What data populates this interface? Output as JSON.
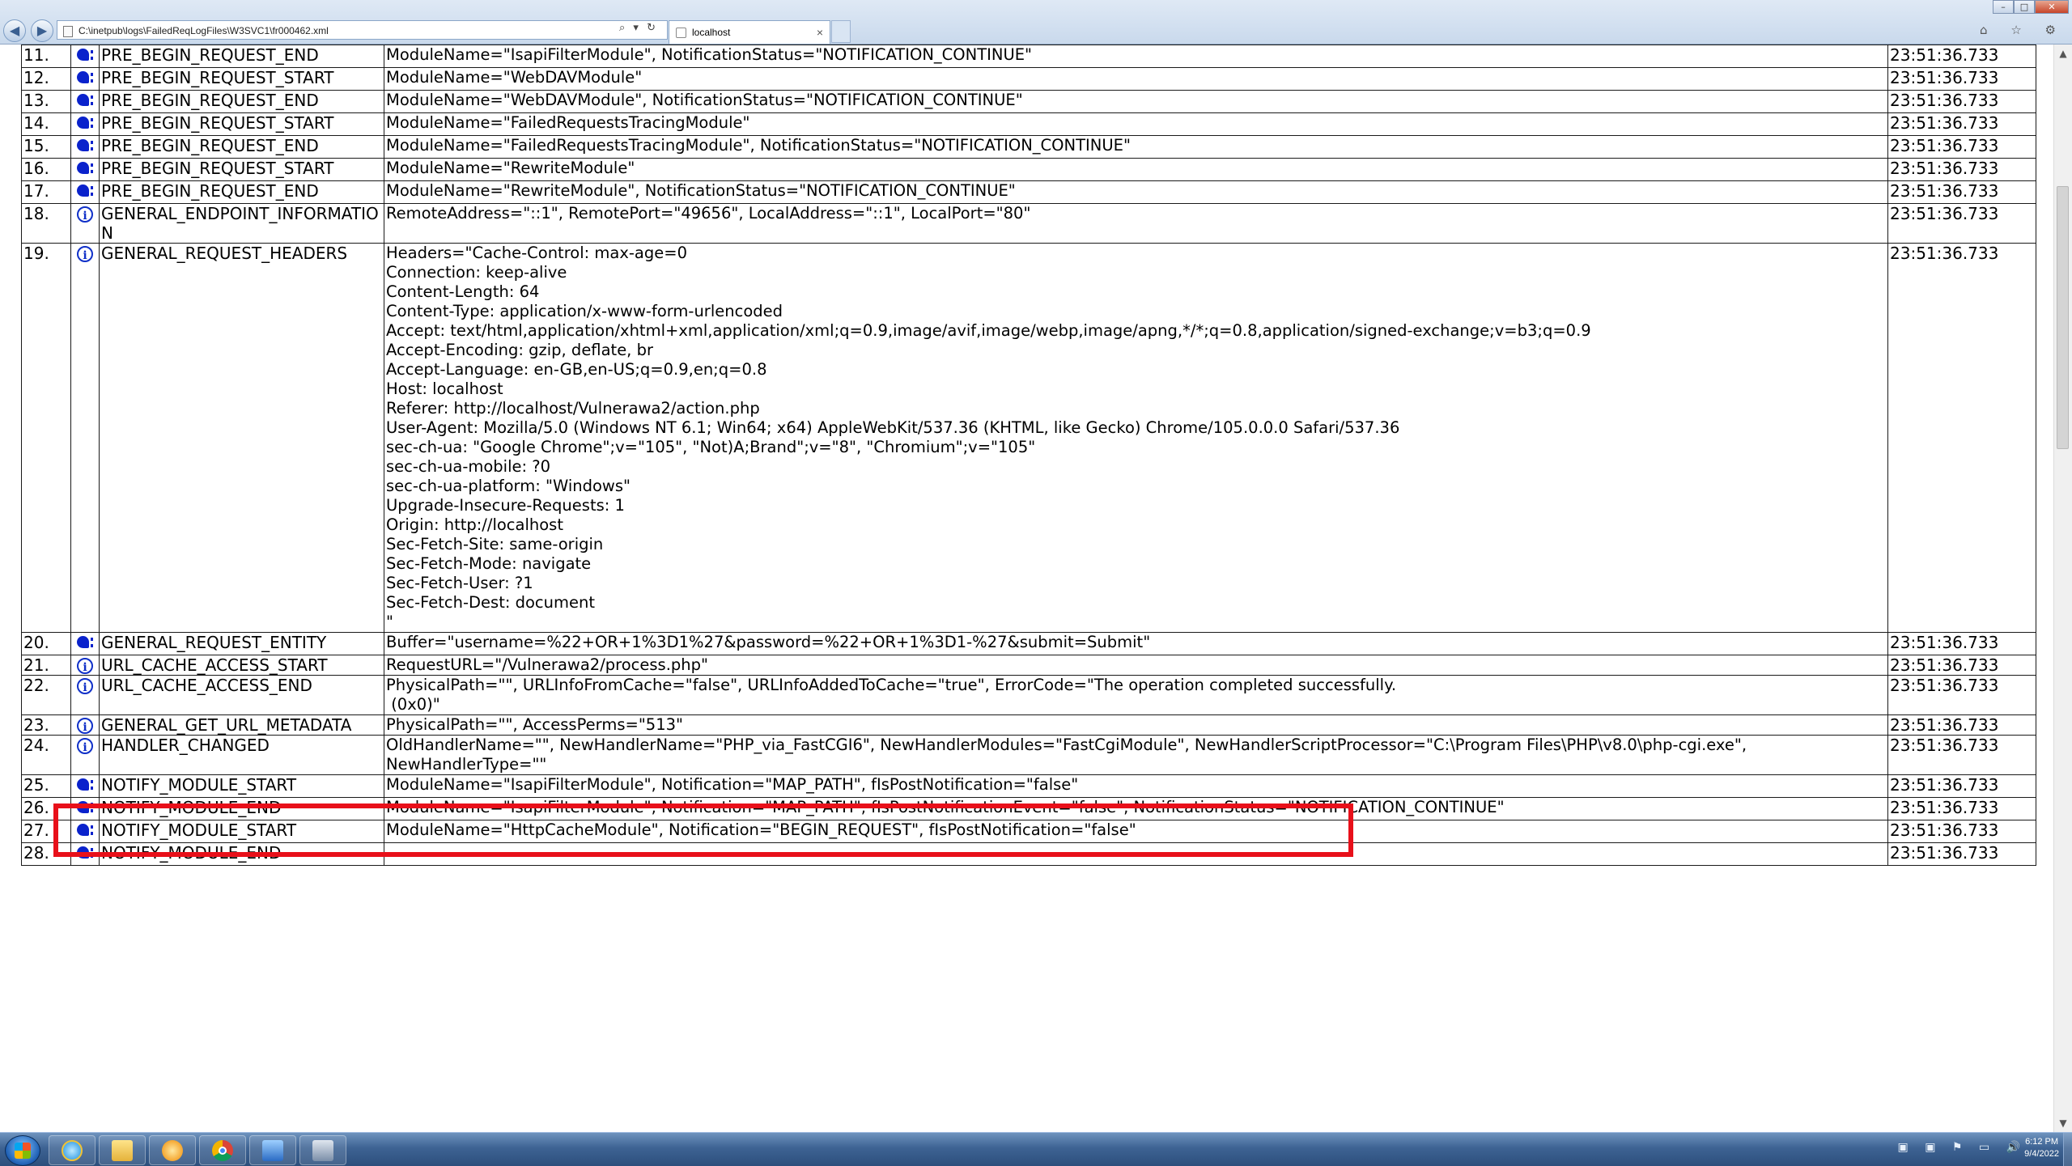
{
  "browser": {
    "address": "C:\\inetpub\\logs\\FailedReqLogFiles\\W3SVC1\\fr000462.xml",
    "address_tools": "⌕ ▾ ↻",
    "tab_title": "localhost",
    "tab_close": "×",
    "back": "◀",
    "forward": "▶",
    "minimize": "–",
    "maximize": "□",
    "close": "✕",
    "home_star_gear": "⌂ ☆ ⚙"
  },
  "log": {
    "rows": [
      {
        "num": "11.",
        "icon": "notify",
        "event": "PRE_BEGIN_REQUEST_END",
        "detail": "ModuleName=\"IsapiFilterModule\", NotificationStatus=\"NOTIFICATION_CONTINUE\"",
        "time": "23:51:36.733"
      },
      {
        "num": "12.",
        "icon": "notify",
        "event": "PRE_BEGIN_REQUEST_START",
        "detail": "ModuleName=\"WebDAVModule\"",
        "time": "23:51:36.733"
      },
      {
        "num": "13.",
        "icon": "notify",
        "event": "PRE_BEGIN_REQUEST_END",
        "detail": "ModuleName=\"WebDAVModule\", NotificationStatus=\"NOTIFICATION_CONTINUE\"",
        "time": "23:51:36.733"
      },
      {
        "num": "14.",
        "icon": "notify",
        "event": "PRE_BEGIN_REQUEST_START",
        "detail": "ModuleName=\"FailedRequestsTracingModule\"",
        "time": "23:51:36.733"
      },
      {
        "num": "15.",
        "icon": "notify",
        "event": "PRE_BEGIN_REQUEST_END",
        "detail": "ModuleName=\"FailedRequestsTracingModule\", NotificationStatus=\"NOTIFICATION_CONTINUE\"",
        "time": "23:51:36.733"
      },
      {
        "num": "16.",
        "icon": "notify",
        "event": "PRE_BEGIN_REQUEST_START",
        "detail": "ModuleName=\"RewriteModule\"",
        "time": "23:51:36.733"
      },
      {
        "num": "17.",
        "icon": "notify",
        "event": "PRE_BEGIN_REQUEST_END",
        "detail": "ModuleName=\"RewriteModule\", NotificationStatus=\"NOTIFICATION_CONTINUE\"",
        "time": "23:51:36.733"
      },
      {
        "num": "18.",
        "icon": "info",
        "event": "GENERAL_ENDPOINT_INFORMATION",
        "detail": "RemoteAddress=\"::1\", RemotePort=\"49656\", LocalAddress=\"::1\", LocalPort=\"80\"",
        "time": "23:51:36.733"
      },
      {
        "num": "19.",
        "icon": "info",
        "event": "GENERAL_REQUEST_HEADERS",
        "detail": "Headers=\"Cache-Control: max-age=0\nConnection: keep-alive\nContent-Length: 64\nContent-Type: application/x-www-form-urlencoded\nAccept: text/html,application/xhtml+xml,application/xml;q=0.9,image/avif,image/webp,image/apng,*/*;q=0.8,application/signed-exchange;v=b3;q=0.9\nAccept-Encoding: gzip, deflate, br\nAccept-Language: en-GB,en-US;q=0.9,en;q=0.8\nHost: localhost\nReferer: http://localhost/Vulnerawa2/action.php\nUser-Agent: Mozilla/5.0 (Windows NT 6.1; Win64; x64) AppleWebKit/537.36 (KHTML, like Gecko) Chrome/105.0.0.0 Safari/537.36\nsec-ch-ua: \"Google Chrome\";v=\"105\", \"Not)A;Brand\";v=\"8\", \"Chromium\";v=\"105\"\nsec-ch-ua-mobile: ?0\nsec-ch-ua-platform: \"Windows\"\nUpgrade-Insecure-Requests: 1\nOrigin: http://localhost\nSec-Fetch-Site: same-origin\nSec-Fetch-Mode: navigate\nSec-Fetch-User: ?1\nSec-Fetch-Dest: document\n\"",
        "time": "23:51:36.733"
      },
      {
        "num": "20.",
        "icon": "notify",
        "event": "GENERAL_REQUEST_ENTITY",
        "detail": "Buffer=\"username=%22+OR+1%3D1%27&password=%22+OR+1%3D1-%27&submit=Submit\"",
        "time": "23:51:36.733"
      },
      {
        "num": "21.",
        "icon": "info",
        "event": "URL_CACHE_ACCESS_START",
        "detail": "RequestURL=\"/Vulnerawa2/process.php\"",
        "time": "23:51:36.733"
      },
      {
        "num": "22.",
        "icon": "info",
        "event": "URL_CACHE_ACCESS_END",
        "detail": "PhysicalPath=\"\", URLInfoFromCache=\"false\", URLInfoAddedToCache=\"true\", ErrorCode=\"The operation completed successfully.\n (0x0)\"",
        "time": "23:51:36.733"
      },
      {
        "num": "23.",
        "icon": "info",
        "event": "GENERAL_GET_URL_METADATA",
        "detail": "PhysicalPath=\"\", AccessPerms=\"513\"",
        "time": "23:51:36.733"
      },
      {
        "num": "24.",
        "icon": "info",
        "event": "HANDLER_CHANGED",
        "detail": "OldHandlerName=\"\", NewHandlerName=\"PHP_via_FastCGI6\", NewHandlerModules=\"FastCgiModule\", NewHandlerScriptProcessor=\"C:\\Program Files\\PHP\\v8.0\\php-cgi.exe\", NewHandlerType=\"\"",
        "time": "23:51:36.733"
      },
      {
        "num": "25.",
        "icon": "notify",
        "event": "NOTIFY_MODULE_START",
        "detail": "ModuleName=\"IsapiFilterModule\", Notification=\"MAP_PATH\", fIsPostNotification=\"false\"",
        "time": "23:51:36.733"
      },
      {
        "num": "26.",
        "icon": "notify",
        "event": "NOTIFY_MODULE_END",
        "detail": "ModuleName=\"IsapiFilterModule\", Notification=\"MAP_PATH\", fIsPostNotificationEvent=\"false\", NotificationStatus=\"NOTIFICATION_CONTINUE\"",
        "time": "23:51:36.733"
      },
      {
        "num": "27.",
        "icon": "notify",
        "event": "NOTIFY_MODULE_START",
        "detail": "ModuleName=\"HttpCacheModule\", Notification=\"BEGIN_REQUEST\", fIsPostNotification=\"false\"",
        "time": "23:51:36.733"
      },
      {
        "num": "28.",
        "icon": "notify",
        "event": "NOTIFY_MODULE_END",
        "detail": "",
        "time": "23:51:36.733"
      }
    ]
  },
  "taskbar": {
    "clock_time": "6:12 PM",
    "clock_date": "9/4/2022",
    "tray_icons": "▣ ▣ ⚑ ▭ 🔊"
  },
  "colors": {
    "highlight": "#e8101a",
    "icon_blue": "#0a22cc"
  }
}
